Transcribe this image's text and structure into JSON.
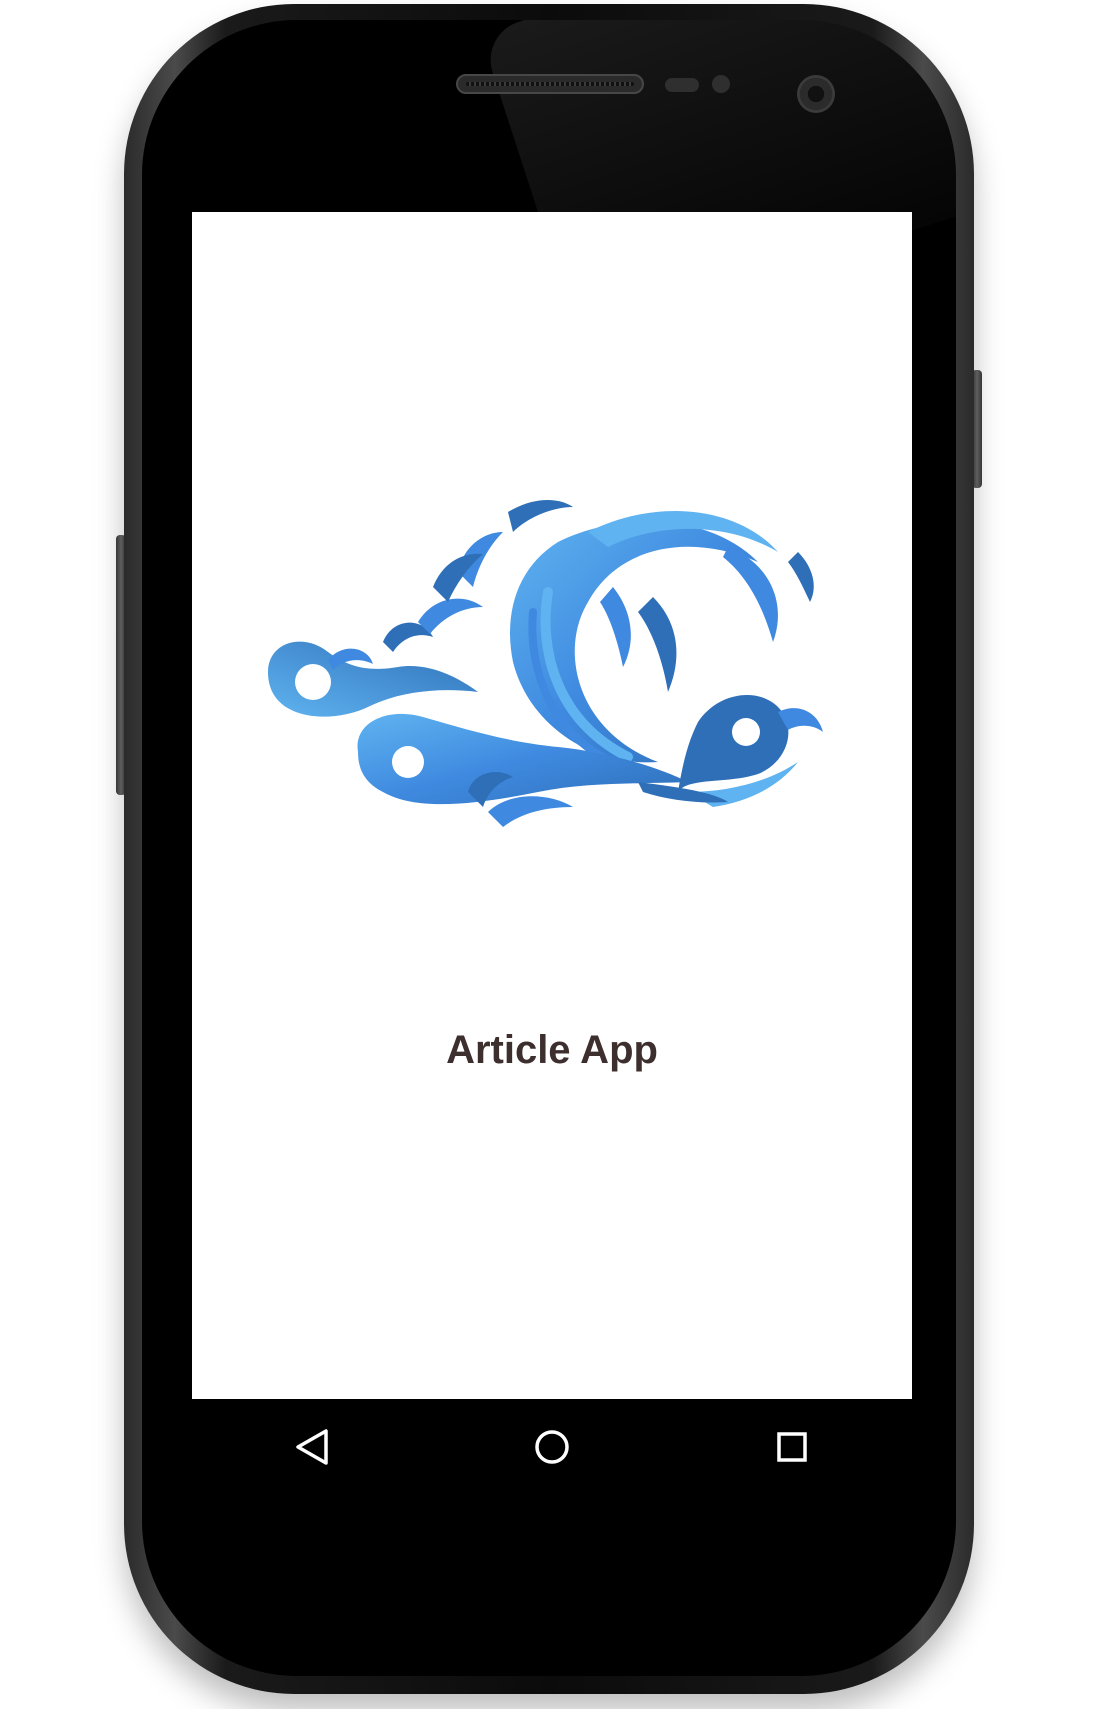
{
  "app": {
    "title": "Article App"
  },
  "logo": {
    "icon": "wave-logo-icon",
    "colors": {
      "dark": "#2e6fb8",
      "mid": "#3f8ae0",
      "light": "#5fb3f0"
    }
  },
  "navigation": {
    "buttons": [
      {
        "icon": "back-triangle-icon"
      },
      {
        "icon": "home-circle-icon"
      },
      {
        "icon": "recents-square-icon"
      }
    ]
  },
  "theme": {
    "screen_background": "#ffffff",
    "title_color": "#3e2f2f",
    "phone_body": "#0b0b0b",
    "navbar_background": "#000000"
  }
}
